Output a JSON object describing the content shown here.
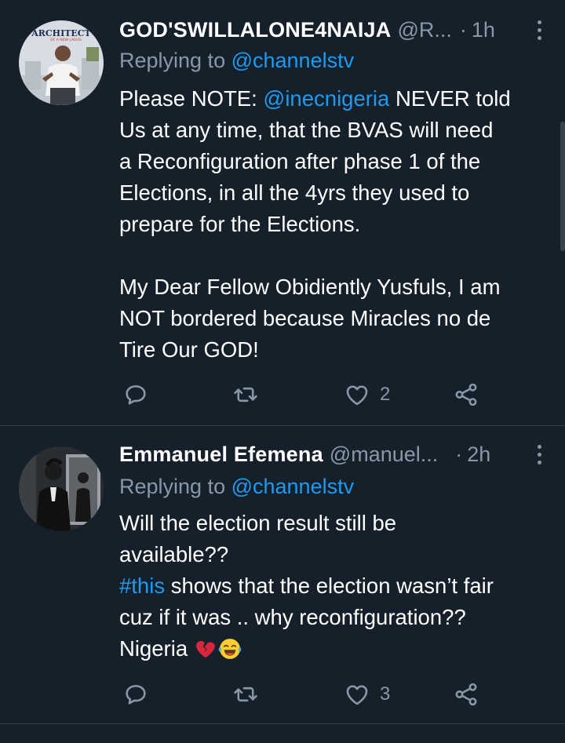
{
  "tweets": [
    {
      "name": "GOD'SWILLALONE4NAIJA",
      "handle": "@R...",
      "separator": "·",
      "time": "1h",
      "replying_prefix": "Replying to ",
      "replying_to": "@channelstv",
      "body_lines": [
        {
          "pre": "Please NOTE: ",
          "mention": "@inecnigeria",
          "post": " NEVER told"
        },
        {
          "text": "Us at any time, that the BVAS will need"
        },
        {
          "text": "a Reconfiguration after phase 1 of the"
        },
        {
          "text": "Elections, in all the 4yrs they used to"
        },
        {
          "text": "prepare for the Elections."
        },
        {
          "text": ""
        },
        {
          "text": "My Dear Fellow Obidiently Yusfuls, I am"
        },
        {
          "text": "NOT bordered because Miracles no de"
        },
        {
          "text": "Tire Our GOD!"
        }
      ],
      "avatar_text": "ARCHITECT",
      "avatar_subtext": "OF A NEW LAGOS",
      "like_count": "2",
      "icons": [
        "reply-icon",
        "retweet-icon",
        "like-icon",
        "share-icon"
      ]
    },
    {
      "name": "Emmanuel Efemena",
      "handle": "@manuel...",
      "separator": "·",
      "time": "2h",
      "replying_prefix": "Replying to ",
      "replying_to": "@channelstv",
      "body_lines": [
        {
          "text": "Will the election result still be"
        },
        {
          "text": "available??"
        },
        {
          "hashtag": "#this",
          "post": " shows that the election wasn’t fair"
        },
        {
          "text": "cuz if it was .. why reconfiguration??"
        },
        {
          "text": "Nigeria "
        }
      ],
      "emojis": [
        "broken-heart-emoji",
        "laughing-tears-emoji"
      ],
      "like_count": "3",
      "icons": [
        "reply-icon",
        "retweet-icon",
        "like-icon",
        "share-icon"
      ]
    }
  ],
  "colors": {
    "background": "#15202b",
    "text": "#ffffff",
    "secondary": "#8899a6",
    "link": "#1d9bf0",
    "divider": "#38444d"
  }
}
